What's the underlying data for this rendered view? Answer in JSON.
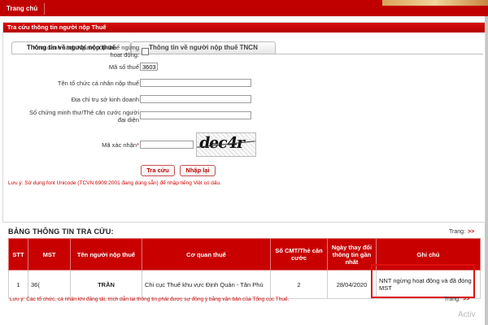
{
  "nav": {
    "home_tab": "Trang chủ"
  },
  "panel": {
    "title": "Tra cứu thông tin người nộp Thuế"
  },
  "tabs": [
    {
      "label": "Thông tin về người nộp thuế",
      "active": true
    },
    {
      "label": "Thông tin về người nộp thuế TNCN",
      "active": false
    }
  ],
  "form": {
    "list_checkbox_label_line1": "Xem danh sách Người nộp thuế ngừng",
    "list_checkbox_label_line2": "hoạt động:",
    "tax_code_label": "Mã số thuế",
    "tax_code_value": "3603",
    "org_name_label": "Tên tổ chức cá nhân nộp thuế",
    "address_label": "Địa chỉ trụ sở kinh doanh",
    "id_label_line1": "Số chứng minh thư/Thẻ căn cước người",
    "id_label_line2": "đại diện",
    "captcha_label": "Mã xác nhận",
    "captcha_text": "dec4r",
    "search_button": "Tra cứu",
    "reset_button": "Nhập lại",
    "note": "Lưu ý: Sử dụng font Unicode (TCVN:6909:2001 đang dùng sẵn) để nhập tiếng Việt có dấu."
  },
  "results": {
    "title": "BẢNG THÔNG TIN TRA CỨU:",
    "pager_label": "Trang:",
    "pager_arrows": ">>",
    "columns": [
      "STT",
      "MST",
      "Tên người nộp thuế",
      "Cơ quan thuế",
      "Số CMT/Thẻ căn cước",
      "Ngày thay đổi thông tin gần nhất",
      "Ghi chú"
    ],
    "rows": [
      {
        "stt": "1",
        "mst": "36(",
        "name": "TRẦN",
        "agency": "Chi cục Thuế khu vực Định Quán - Tân Phú",
        "id_no": "2",
        "date": "28/04/2020",
        "note": "NNT ngừng hoạt động và đã đóng MST"
      }
    ],
    "bottom_note": "Lưu ý: Các tổ chức, cá nhân khi đăng tải, trích dẫn lại thông tin phải được sự đồng ý bằng văn bản của Tổng cục Thuế.",
    "bottom_pager_label": "Trang:",
    "bottom_pager_arrows": ">>"
  },
  "watermark": "Activ"
}
